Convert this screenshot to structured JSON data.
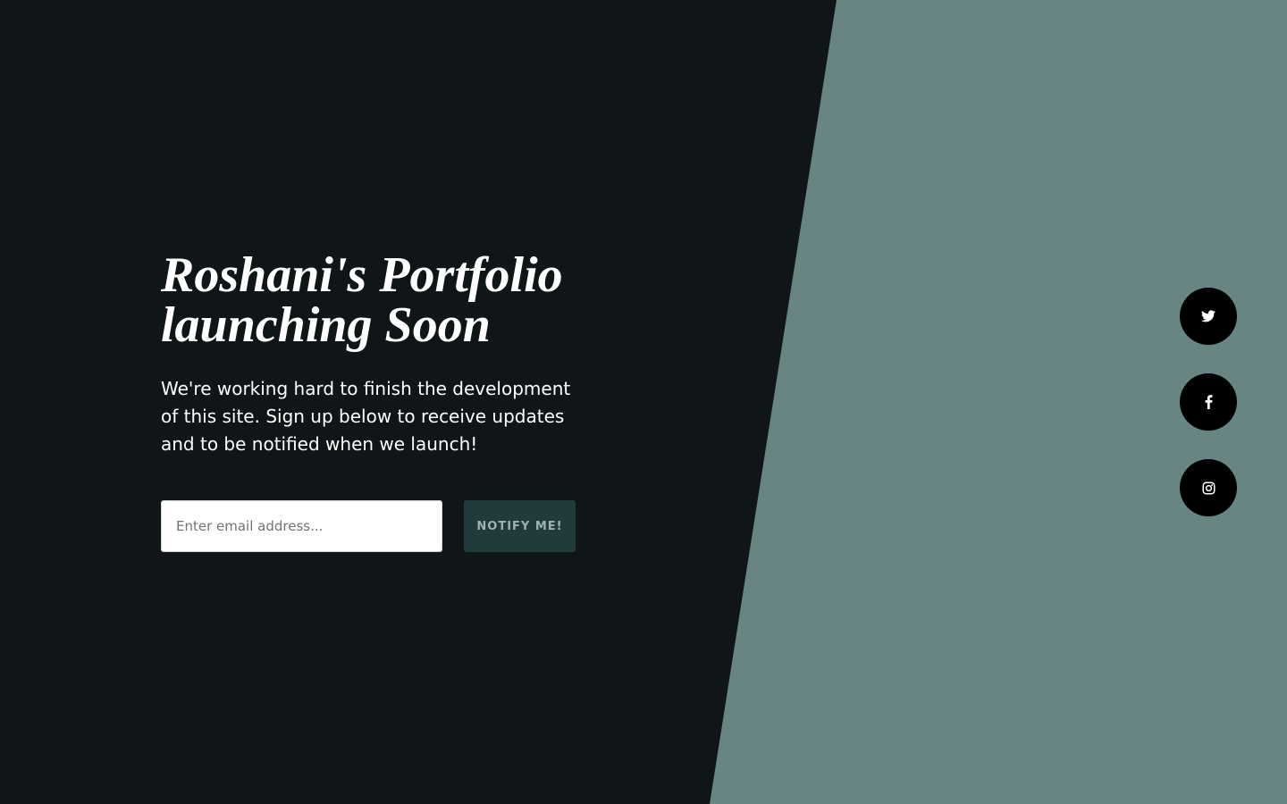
{
  "page": {
    "headline_line1": "Roshani's Portfolio",
    "headline_line2": "launching Soon",
    "subtext": "We're working hard to finish the development of this site. Sign up below to receive updates and to be notified when we launch!"
  },
  "form": {
    "email_placeholder": "Enter email address...",
    "email_value": "",
    "submit_label": "NOTIFY ME!"
  },
  "social": {
    "items": [
      {
        "icon": "twitter-icon"
      },
      {
        "icon": "facebook-icon"
      },
      {
        "icon": "instagram-icon"
      }
    ]
  },
  "colors": {
    "dark_background": "#101617",
    "accent_background": "#688584",
    "button_background": "#213a3c",
    "button_text": "#9fb2b1",
    "social_background": "#000000"
  }
}
